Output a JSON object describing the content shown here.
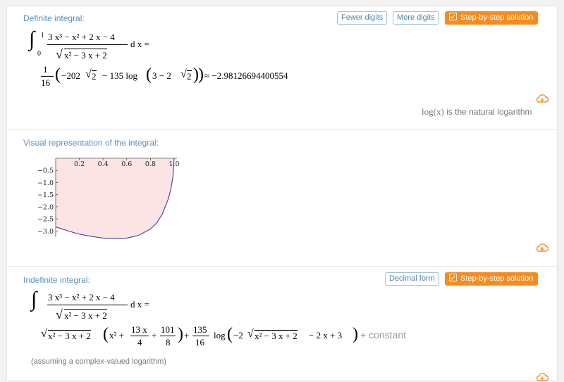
{
  "pod1": {
    "title": "Definite integral:",
    "buttons": {
      "fewer": "Fewer digits",
      "more": "More digits",
      "step": "Step-by-step solution"
    },
    "integral": {
      "upper": "1",
      "lower": "0",
      "numerator": "3 x³ − x² + 2 x − 4",
      "denominator": "x² − 3 x + 2",
      "dx": "d x ="
    },
    "result": {
      "frac_num": "1",
      "frac_den": "16",
      "expr_a": "−202",
      "expr_b": "2",
      "expr_c": "− 135 log",
      "expr_d": "3 − 2",
      "expr_e": "2",
      "approx": "≈ −2.98126694400554"
    },
    "footnote_func": "log(x)",
    "footnote_text": " is the natural logarithm"
  },
  "pod2": {
    "title": "Visual representation of the integral:"
  },
  "pod3": {
    "title": "Indefinite integral:",
    "buttons": {
      "decimal": "Decimal form",
      "step": "Step-by-step solution"
    },
    "integral": {
      "numerator": "3 x³ − x² + 2 x − 4",
      "denominator": "x² − 3 x + 2",
      "dx": "d x ="
    },
    "result": {
      "sqrt": "x² − 3 x + 2",
      "paren_a": "x² +",
      "f1_num": "13 x",
      "f1_den": "4",
      "f2_num": "101",
      "f2_den": "8",
      "plus": "+",
      "f3_num": "135",
      "f3_den": "16",
      "log": "log",
      "log_a": "−2",
      "log_sqrt": "x² − 3 x + 2",
      "log_b": "− 2 x + 3",
      "constant": "+ constant"
    },
    "assumption": "(assuming a complex-valued logarithm)"
  },
  "chart_data": {
    "type": "area",
    "title": "",
    "xlabel": "",
    "ylabel": "",
    "xlim": [
      0,
      1
    ],
    "ylim": [
      -3.25,
      0
    ],
    "x_ticks": [
      "0.2",
      "0.4",
      "0.6",
      "0.8",
      "1.0"
    ],
    "y_ticks": [
      "−0.5",
      "−1.0",
      "−1.5",
      "−2.0",
      "−2.5",
      "−3.0"
    ],
    "function": "(3x^3 - x^2 + 2x - 4) / sqrt(x^2 - 3x + 2)",
    "x": [
      0,
      0.1,
      0.2,
      0.3,
      0.4,
      0.5,
      0.6,
      0.7,
      0.8,
      0.85,
      0.9,
      0.95,
      0.97,
      0.99
    ],
    "y": [
      -2.83,
      -2.99,
      -3.13,
      -3.22,
      -3.29,
      -3.31,
      -3.29,
      -3.18,
      -2.92,
      -2.68,
      -2.31,
      -1.68,
      -1.32,
      -0.77
    ],
    "fill_color": "#fde4e4",
    "line_color": "#3e3f96"
  },
  "colors": {
    "accent": "#f68b1f",
    "title": "#5a90c1"
  },
  "icons": {
    "save": "cloud-download-icon"
  }
}
